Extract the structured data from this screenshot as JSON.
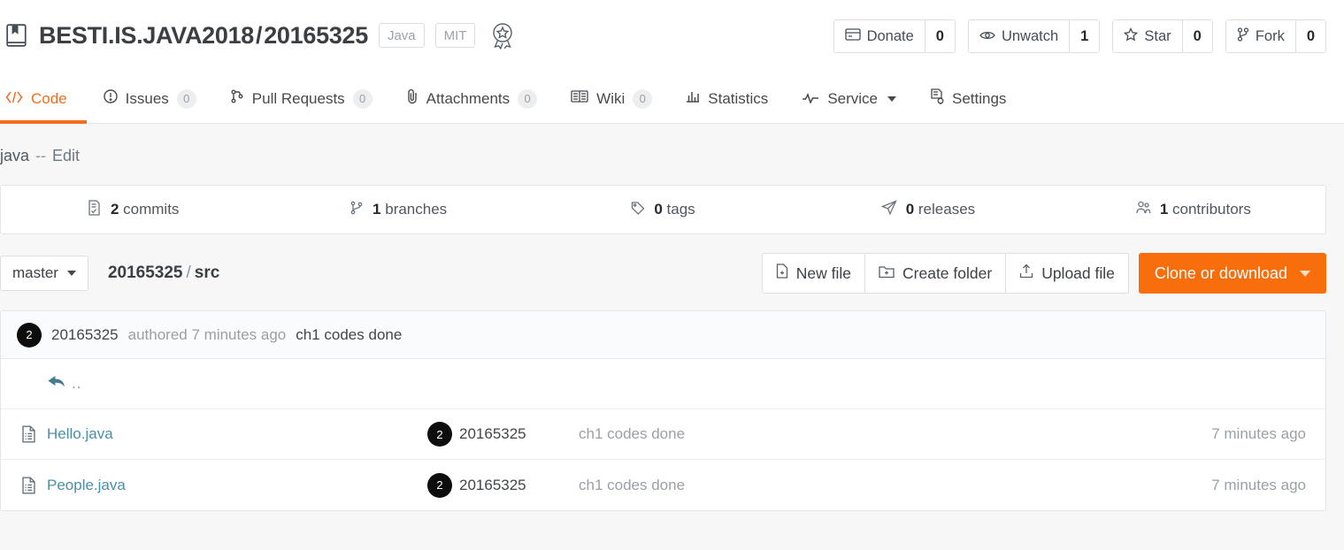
{
  "header": {
    "book_icon": "repo-book-icon",
    "owner": "BESTI.IS.JAVA2018",
    "separator": "/",
    "repo": "20165325",
    "language_label": "Java",
    "license_label": "MIT",
    "award_icon": "award-badge-icon",
    "actions": [
      {
        "icon": "donate-icon",
        "label": "Donate",
        "count": "0"
      },
      {
        "icon": "eye-icon",
        "label": "Unwatch",
        "count": "1"
      },
      {
        "icon": "star-icon",
        "label": "Star",
        "count": "0"
      },
      {
        "icon": "fork-icon",
        "label": "Fork",
        "count": "0"
      }
    ]
  },
  "tabs": [
    {
      "icon": "code-icon",
      "label": "Code",
      "badge": null,
      "active": true
    },
    {
      "icon": "issue-icon",
      "label": "Issues",
      "badge": "0",
      "active": false
    },
    {
      "icon": "pull-request-icon",
      "label": "Pull Requests",
      "badge": "0",
      "active": false
    },
    {
      "icon": "paperclip-icon",
      "label": "Attachments",
      "badge": "0",
      "active": false
    },
    {
      "icon": "wiki-icon",
      "label": "Wiki",
      "badge": "0",
      "active": false
    },
    {
      "icon": "statistics-icon",
      "label": "Statistics",
      "badge": null,
      "active": false
    },
    {
      "icon": "service-icon",
      "label": "Service",
      "badge": null,
      "active": false,
      "caret": true
    },
    {
      "icon": "settings-icon",
      "label": "Settings",
      "badge": null,
      "active": false
    }
  ],
  "description": {
    "text": "java",
    "dashes": "--",
    "edit_label": "Edit"
  },
  "stats": [
    {
      "icon": "commits-icon",
      "count": "2",
      "label": "commits"
    },
    {
      "icon": "branches-icon",
      "count": "1",
      "label": "branches"
    },
    {
      "icon": "tags-icon",
      "count": "0",
      "label": "tags"
    },
    {
      "icon": "releases-icon",
      "count": "0",
      "label": "releases"
    },
    {
      "icon": "contributors-icon",
      "count": "1",
      "label": "contributors"
    }
  ],
  "toolbar": {
    "branch_label": "master",
    "breadcrumb_root": "20165325",
    "breadcrumb_sep": "/",
    "breadcrumb_current": "src",
    "new_file_label": "New file",
    "create_folder_label": "Create folder",
    "upload_file_label": "Upload file",
    "clone_label": "Clone or download"
  },
  "commit_bar": {
    "avatar_initial": "2",
    "author": "20165325",
    "meta": "authored 7 minutes ago",
    "message": "ch1 codes done"
  },
  "file_list": {
    "up_row_label": "..",
    "rows": [
      {
        "icon": "file-icon",
        "name": "Hello.java",
        "avatar_initial": "2",
        "author": "20165325",
        "message": "ch1 codes done",
        "time": "7 minutes ago"
      },
      {
        "icon": "file-icon",
        "name": "People.java",
        "avatar_initial": "2",
        "author": "20165325",
        "message": "ch1 codes done",
        "time": "7 minutes ago"
      }
    ]
  },
  "colors": {
    "accent_orange": "#f96e0c",
    "tab_active": "#f26d21",
    "link_blue": "#4a8fa8",
    "page_bg": "#f7f7f7"
  }
}
